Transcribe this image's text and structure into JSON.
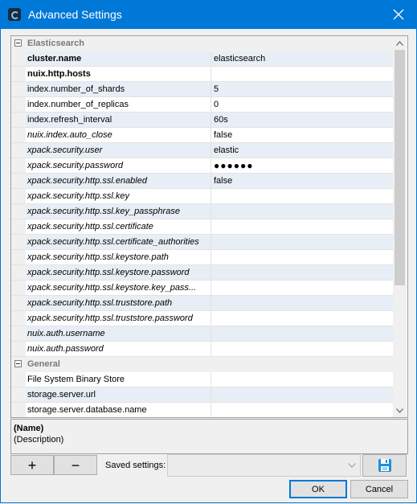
{
  "window": {
    "title": "Advanced Settings",
    "accent_color": "#0078d7",
    "icons": {
      "app": "app-icon",
      "close": "close-icon"
    }
  },
  "grid": {
    "categories": [
      {
        "label": "Elasticsearch",
        "expanded": true,
        "rows": [
          {
            "name": "cluster.name",
            "value": "elasticsearch",
            "style": "bold",
            "shaded": true
          },
          {
            "name": "nuix.http.hosts",
            "value": "",
            "style": "bold",
            "shaded": false
          },
          {
            "name": "index.number_of_shards",
            "value": "5",
            "style": "normal",
            "shaded": true
          },
          {
            "name": "index.number_of_replicas",
            "value": "0",
            "style": "normal",
            "shaded": false
          },
          {
            "name": "index.refresh_interval",
            "value": "60s",
            "style": "normal",
            "shaded": true
          },
          {
            "name": "nuix.index.auto_close",
            "value": "false",
            "style": "italic",
            "shaded": false
          },
          {
            "name": "xpack.security.user",
            "value": "elastic",
            "style": "italic",
            "shaded": true
          },
          {
            "name": "xpack.security.password",
            "value": "●●●●●●",
            "style": "italic",
            "shaded": false,
            "masked": true
          },
          {
            "name": "xpack.security.http.ssl.enabled",
            "value": "false",
            "style": "italic",
            "shaded": true
          },
          {
            "name": "xpack.security.http.ssl.key",
            "value": "",
            "style": "italic",
            "shaded": false
          },
          {
            "name": "xpack.security.http.ssl.key_passphrase",
            "value": "",
            "style": "italic",
            "shaded": true
          },
          {
            "name": "xpack.security.http.ssl.certificate",
            "value": "",
            "style": "italic",
            "shaded": false
          },
          {
            "name": "xpack.security.http.ssl.certificate_authorities",
            "value": "",
            "style": "italic",
            "shaded": true
          },
          {
            "name": "xpack.security.http.ssl.keystore.path",
            "value": "",
            "style": "italic",
            "shaded": false
          },
          {
            "name": "xpack.security.http.ssl.keystore.password",
            "value": "",
            "style": "italic",
            "shaded": true
          },
          {
            "name": "xpack.security.http.ssl.keystore.key_pass...",
            "value": "",
            "style": "italic",
            "shaded": false
          },
          {
            "name": "xpack.security.http.ssl.truststore.path",
            "value": "",
            "style": "italic",
            "shaded": true
          },
          {
            "name": "xpack.security.http.ssl.truststore.password",
            "value": "",
            "style": "italic",
            "shaded": false
          },
          {
            "name": "nuix.auth.username",
            "value": "",
            "style": "italic",
            "shaded": true
          },
          {
            "name": "nuix.auth.password",
            "value": "",
            "style": "italic",
            "shaded": false
          }
        ]
      },
      {
        "label": "General",
        "expanded": true,
        "rows": [
          {
            "name": "File System Binary Store",
            "value": "",
            "style": "normal",
            "shaded": false
          },
          {
            "name": "storage.server.url",
            "value": "",
            "style": "normal",
            "shaded": true
          },
          {
            "name": "storage.server.database.name",
            "value": "",
            "style": "normal",
            "shaded": false
          }
        ]
      }
    ],
    "shade_color": "#e8eef5"
  },
  "description": {
    "name": "(Name)",
    "text": "(Description)"
  },
  "toolbar": {
    "add_label": "+",
    "remove_label": "−",
    "saved_settings_label": "Saved settings:",
    "saved_settings_value": "",
    "save_icon": "save-icon"
  },
  "footer": {
    "ok_label": "OK",
    "cancel_label": "Cancel"
  }
}
